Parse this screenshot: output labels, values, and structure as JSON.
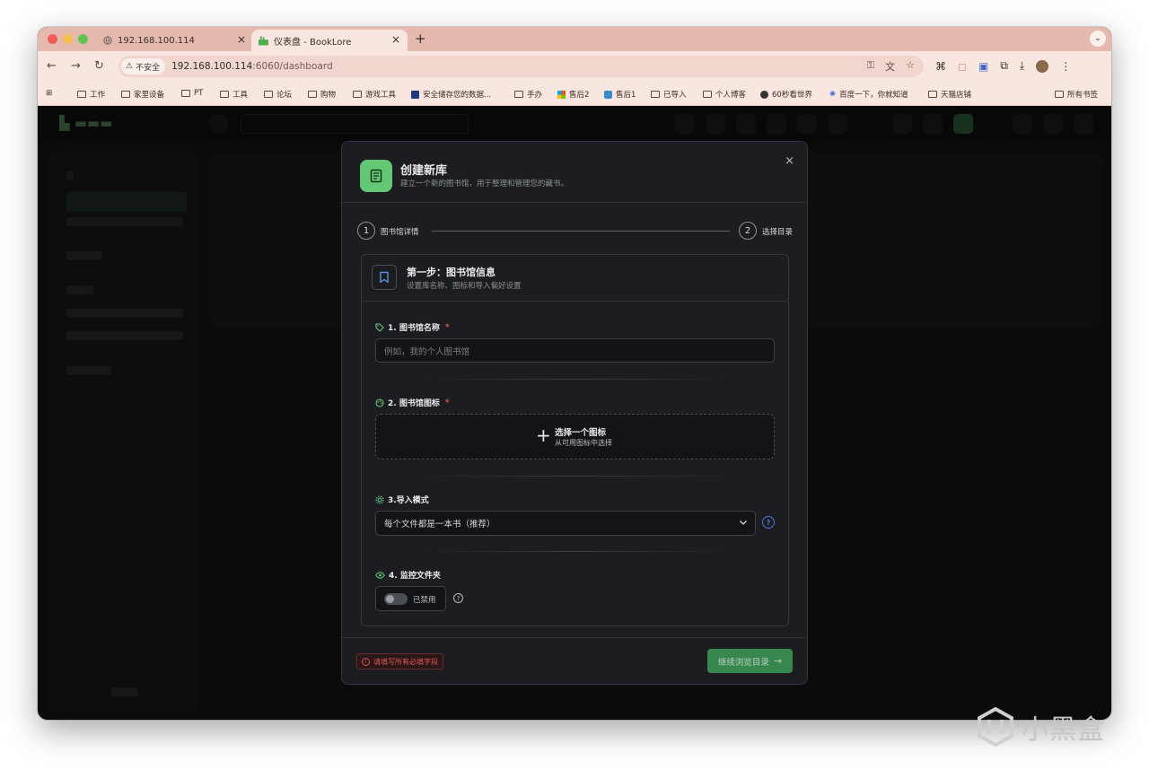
{
  "browser": {
    "tabs": [
      {
        "title": "192.168.100.114",
        "active": false
      },
      {
        "title": "仪表盘 - BookLore",
        "active": true
      }
    ],
    "new_tab": "+",
    "tab_menu": "⌄",
    "insecure_label": "不安全",
    "url_host": "192.168.100.114",
    "url_path": ":6060/dashboard"
  },
  "bookmarks": {
    "items": [
      "工作",
      "家里设备",
      "PT",
      "工具",
      "论坛",
      "购物",
      "游戏工具",
      "安全储存您的数据...",
      "手办",
      "售后2",
      "售后1",
      "已导入",
      "个人博客",
      "60秒看世界",
      "百度一下，你就知道",
      "天猫店铺"
    ],
    "all_bookmarks": "所有书签"
  },
  "modal": {
    "title": "创建新库",
    "subtitle": "建立一个新的图书馆，用于整理和管理您的藏书。",
    "close": "×",
    "steps": [
      {
        "num": "1",
        "label": "图书馆详情"
      },
      {
        "num": "2",
        "label": "选择目录"
      }
    ],
    "section": {
      "title": "第一步：图书馆信息",
      "subtitle": "设置库名称、图标和导入偏好设置"
    },
    "fields": {
      "name_label": "1. 图书馆名称",
      "name_placeholder": "例如，我的个人图书馆",
      "icon_label": "2. 图书馆图标",
      "icon_picker_title": "选择一个图标",
      "icon_picker_sub": "从可用图标中选择",
      "import_label": "3.导入模式",
      "import_value": "每个文件都是一本书（推荐）",
      "watch_label": "4. 监控文件夹",
      "watch_state": "已禁用",
      "required_mark": "*"
    },
    "footer": {
      "error": "请填写所有必填字段",
      "next": "继续浏览目录"
    }
  },
  "watermark": "小黑盒",
  "colors": {
    "accent": "#63c776",
    "error": "#e05555",
    "help": "#4d7cdb"
  }
}
